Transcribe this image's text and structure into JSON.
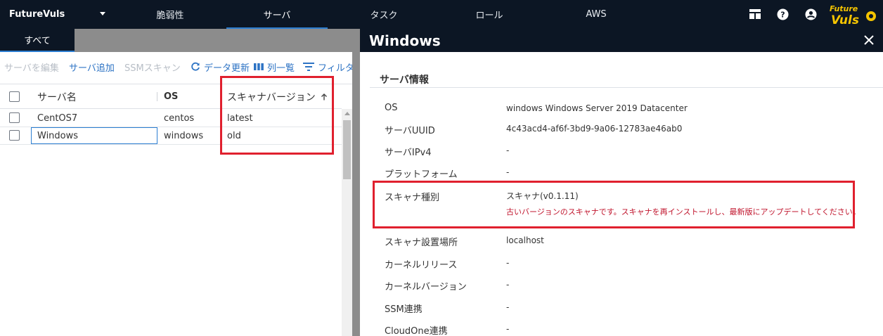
{
  "nav": {
    "brand": "FutureVuls",
    "tabs": [
      {
        "label": "脆弱性"
      },
      {
        "label": "サーバ"
      },
      {
        "label": "タスク"
      },
      {
        "label": "ロール"
      },
      {
        "label": "AWS"
      }
    ],
    "active_tab": "サーバ",
    "logo_text_top": "Future",
    "logo_text_bottom": "Vuls",
    "icons": [
      "dashboard-icon",
      "help-icon",
      "account-icon"
    ]
  },
  "left": {
    "tab_label": "すべて",
    "toolbar": {
      "edit_server": "サーバを編集",
      "add_server": "サーバ追加",
      "ssm_scan": "SSMスキャン",
      "refresh": "データ更新",
      "columns": "列一覧",
      "filter": "フィルタ"
    },
    "columns": [
      "サーバ名",
      "OS",
      "スキャナバージョン"
    ],
    "rows": [
      {
        "name": "CentOS7",
        "os": "centos",
        "scanner": "latest"
      },
      {
        "name": "Windows",
        "os": "windows",
        "scanner": "old"
      }
    ]
  },
  "drawer": {
    "title": "Windows",
    "section": "サーバ情報",
    "fields": [
      {
        "label": "OS",
        "value": "windows Windows Server 2019 Datacenter"
      },
      {
        "label": "サーバUUID",
        "value": "4c43acd4-af6f-3bd9-9a06-12783ae46ab0"
      },
      {
        "label": "サーバIPv4",
        "value": "-"
      },
      {
        "label": "プラットフォーム",
        "value": "-"
      },
      {
        "label": "スキャナ種別",
        "value": "スキャナ(v0.1.11)"
      },
      {
        "label": "スキャナ設置場所",
        "value": "localhost"
      },
      {
        "label": "カーネルリリース",
        "value": "-"
      },
      {
        "label": "カーネルバージョン",
        "value": "-"
      },
      {
        "label": "SSM連携",
        "value": "-"
      },
      {
        "label": "CloudOne連携",
        "value": "-"
      }
    ],
    "scanner_warning": "古いバージョンのスキャナです。スキャナを再インストールし、最新版にアップデートしてください。"
  },
  "colors": {
    "nav_bg": "#0c1624",
    "accent": "#2d7fd2",
    "link": "#2d73c4",
    "warning": "#c0142c",
    "highlight": "#e0202e"
  }
}
